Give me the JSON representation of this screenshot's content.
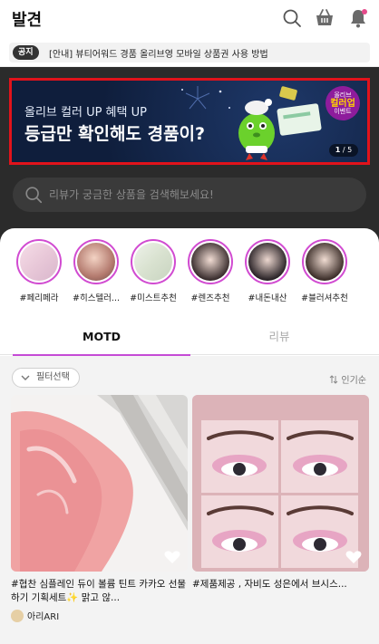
{
  "header": {
    "title": "발견"
  },
  "notice": {
    "badge": "공지",
    "text": "[안내] 뷰티어워드 경품 올리브영 모바일 상품권 사용 방법"
  },
  "banner": {
    "line1": "올리브 컬러 UP 혜택 UP",
    "line2": "등급만 확인해도 경품이?",
    "badge_top": "올리브",
    "badge_mid": "컬러업",
    "badge_bottom": "이벤트",
    "page_current": "1",
    "page_total": "/ 5"
  },
  "search": {
    "placeholder": "리뷰가 궁금한 상품을 검색해보세요!"
  },
  "stories": [
    {
      "label": "#페리페라"
    },
    {
      "label": "#히스텔러..."
    },
    {
      "label": "#미스트추천"
    },
    {
      "label": "#렌즈추천"
    },
    {
      "label": "#내돈내산"
    },
    {
      "label": "#블러셔추천"
    }
  ],
  "tabs": [
    {
      "label": "MOTD"
    },
    {
      "label": "리뷰"
    }
  ],
  "feed": {
    "filter_label": "필터선택",
    "sort_label": "인기순",
    "cards": [
      {
        "caption": "#협찬 심플레인 듀이 볼륨 틴트 카카오 선물하기 기획세트✨ 맑고 않...",
        "author": "아리ARI"
      },
      {
        "caption": "#제품제공 , 자비도 성은에서 브시스...",
        "author": ""
      }
    ]
  },
  "colors": {
    "accent": "#c54bd6",
    "banner_outline": "#e1131b",
    "dark_bg": "#2b2b2b"
  }
}
